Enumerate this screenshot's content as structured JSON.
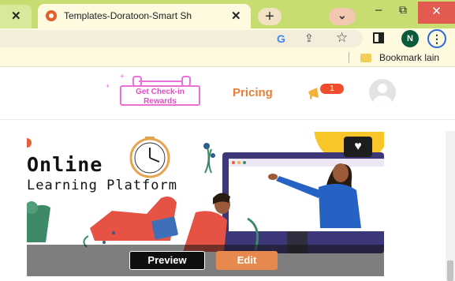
{
  "browser": {
    "prev_tab_close": "✕",
    "active_tab": {
      "title": "Templates-Doratoon-Smart Sh",
      "close": "✕"
    },
    "new_tab": "+",
    "tab_search": "⌄",
    "controls": {
      "minimize": "–",
      "restore": "⧉",
      "close": "✕"
    },
    "toolbar": {
      "google": "G",
      "share": "⇪",
      "star": "☆",
      "sidebar": "▮",
      "profile_initial": "N",
      "menu": "⋮"
    },
    "bookmark": {
      "label": "Bookmark lain"
    }
  },
  "site": {
    "checkin": {
      "line1": "Get Check-in",
      "line2": "Rewards"
    },
    "pricing": "Pricing",
    "notification_count": "1",
    "card": {
      "title": "Online",
      "subtitle": "Learning Platform",
      "favorite": "♥",
      "preview": "Preview",
      "edit": "Edit"
    }
  },
  "colors": {
    "tabstrip": "#c7dd71",
    "accent_orange": "#e47f3a",
    "checkin_pink": "#e44bc5",
    "badge_red": "#ef4d2d",
    "edit_orange": "#e7884e",
    "monitor": "#3b3779"
  }
}
